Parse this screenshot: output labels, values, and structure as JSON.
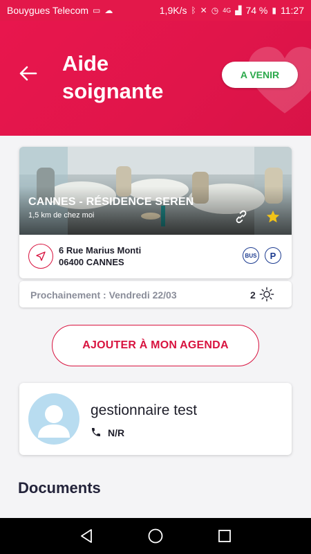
{
  "status_bar": {
    "carrier": "Bouygues Telecom",
    "speed": "1,9K/s",
    "battery": "74 %",
    "time": "11:27",
    "network": "4G"
  },
  "header": {
    "title": "Aide soignante",
    "filter_button": "A VENIR",
    "colors": {
      "primary": "#e3184a",
      "accent_green": "#2aa84a"
    }
  },
  "event": {
    "title": "CANNES - RÉSIDENCE SEREN",
    "distance": "1,5 km de chez moi",
    "address_line1": "6 Rue Marius Monti",
    "address_line2": "06400 CANNES",
    "transport": {
      "bus": "BUS",
      "parking": "P"
    },
    "icons": [
      "link-icon",
      "star-icon",
      "navigation-icon"
    ]
  },
  "upcoming": {
    "label": "Prochainement : Vendredi 22/03",
    "count": "2"
  },
  "agenda_button": "AJOUTER À MON AGENDA",
  "manager": {
    "name": "gestionnaire test",
    "phone": "N/R"
  },
  "documents_title": "Documents"
}
